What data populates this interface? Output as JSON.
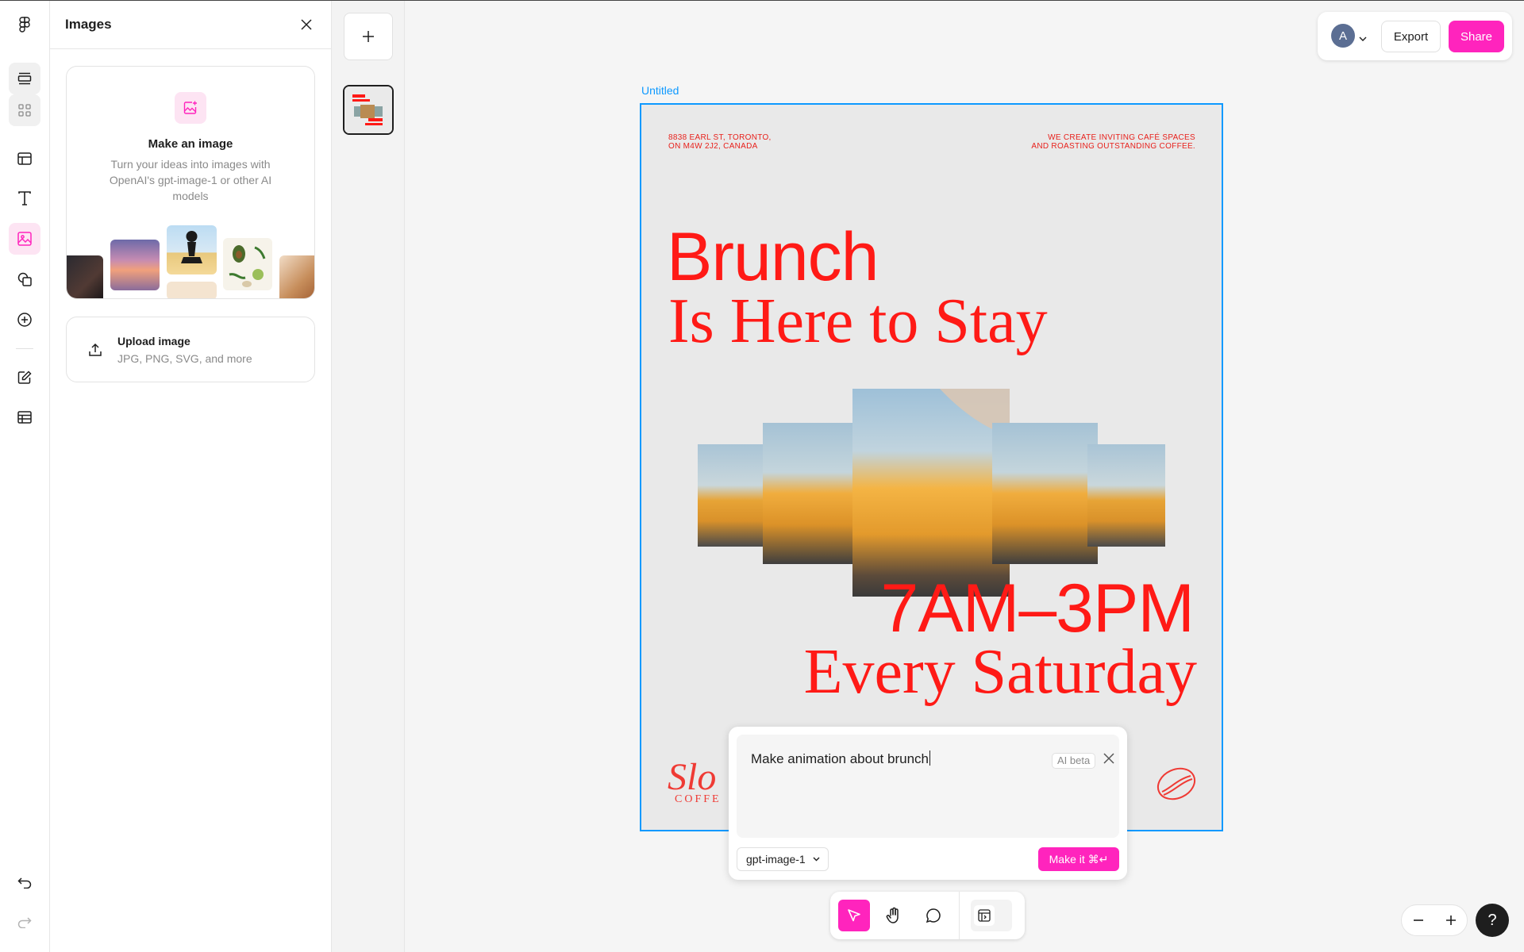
{
  "panel": {
    "title": "Images",
    "make_card": {
      "title": "Make an image",
      "description": "Turn your ideas into images with OpenAI's gpt-image-1 or other AI models"
    },
    "upload_card": {
      "title": "Upload image",
      "subtitle": "JPG, PNG, SVG, and more"
    }
  },
  "rail": {
    "icons": [
      "figma-logo-icon",
      "layers-icon",
      "components-grid-icon",
      "frame-layout-icon",
      "text-icon",
      "image-icon",
      "shapes-icon",
      "plus-circle-icon",
      "edit-icon",
      "table-icon",
      "undo-icon",
      "redo-icon"
    ]
  },
  "topbar": {
    "avatar_letter": "A",
    "export_label": "Export",
    "share_label": "Share"
  },
  "canvas": {
    "frame_name": "Untitled",
    "poster": {
      "address_left": [
        "8838 EARL ST, TORONTO,",
        "ON M4W 2J2, CANADA"
      ],
      "address_right": [
        "WE CREATE INVITING CAFÉ SPACES",
        "AND ROASTING OUTSTANDING COFFEE."
      ],
      "headline_1": "Brunch",
      "headline_2": "Is Here to Stay",
      "time": "7AM–3PM",
      "day": "Every Saturday",
      "logo_script": "Slo",
      "logo_sub": "COFFE"
    }
  },
  "ai_prompt": {
    "text": "Make animation about brunch",
    "badge": "AI beta",
    "model": "gpt-image-1",
    "submit_label": "Make it ⌘↵"
  },
  "help_label": "?",
  "colors": {
    "accent": "#ff24bd",
    "selection": "#0d99ff",
    "poster_red": "#ff1a16"
  }
}
